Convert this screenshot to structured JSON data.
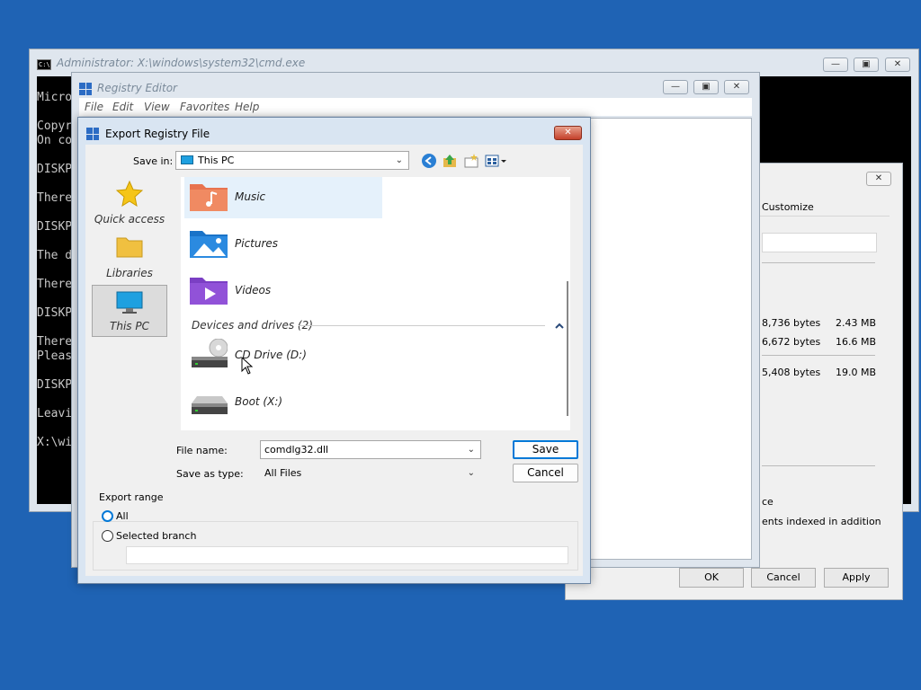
{
  "cmd": {
    "title": "Administrator: X:\\windows\\system32\\cmd.exe",
    "icon_text": "C:\\",
    "lines": [
      "Micro",
      "Copyr",
      "On co",
      "DISKP",
      "There",
      "DISKP",
      "The d",
      "There",
      "DISKP",
      "There",
      "Pleas",
      "DISKP",
      "Leavi",
      "X:\\wi"
    ]
  },
  "regedit": {
    "title": "Registry Editor",
    "menu": [
      "File",
      "Edit",
      "View",
      "Favorites",
      "Help"
    ]
  },
  "properties": {
    "tab_label": "Customize",
    "rows": [
      {
        "bytes": "8,736 bytes",
        "size": "2.43 MB"
      },
      {
        "bytes": "6,672 bytes",
        "size": "16.6 MB"
      },
      {
        "bytes": "5,408 bytes",
        "size": "19.0 MB"
      }
    ],
    "text_ce": "ce",
    "text_indexed": "ents indexed in addition",
    "ok_label": "OK",
    "cancel_label": "Cancel",
    "apply_label": "Apply"
  },
  "dialog": {
    "title": "Export Registry File",
    "save_in_label": "Save in:",
    "save_in_value": "This PC",
    "places": [
      {
        "label": "Quick access",
        "icon": "star-icon"
      },
      {
        "label": "Libraries",
        "icon": "folder-icon"
      },
      {
        "label": "This PC",
        "icon": "monitor-icon",
        "selected": true
      }
    ],
    "items": [
      {
        "name": "Music",
        "icon": "music-folder-icon"
      },
      {
        "name": "Pictures",
        "icon": "pictures-folder-icon"
      },
      {
        "name": "Videos",
        "icon": "videos-folder-icon"
      }
    ],
    "group_header": "Devices and drives (2)",
    "drives": [
      {
        "name": "CD Drive (D:)",
        "icon": "cd-drive-icon"
      },
      {
        "name": "Boot (X:)",
        "icon": "drive-icon"
      }
    ],
    "file_name_label": "File name:",
    "file_name_value": "comdlg32.dll",
    "save_type_label": "Save as type:",
    "save_type_value": "All Files",
    "save_label": "Save",
    "cancel_label": "Cancel",
    "export_range_label": "Export range",
    "all_label": "All",
    "selected_branch_label": "Selected branch",
    "selected_branch_value": ""
  },
  "colors": {
    "desktop": "#1f63b4",
    "accent": "#0078d7"
  }
}
